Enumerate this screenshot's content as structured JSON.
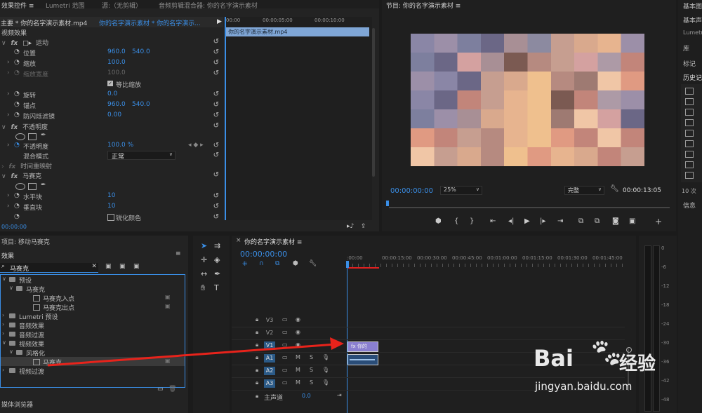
{
  "effect_controls": {
    "tabs": [
      "效果控件 ≡",
      "Lumetri 范围",
      "源:（无剪辑）",
      "音频剪辑混合器: 你的名字演示素材"
    ],
    "source_main": "主要 * 你的名字演示素材.mp4",
    "source_seq": "你的名字演示素材 * 你的名字演示...",
    "section_video": "视频效果",
    "motion": "运动",
    "position": "位置",
    "pos_x": "960.0",
    "pos_y": "540.0",
    "scale": "缩放",
    "scale_v": "100.0",
    "scale_w": "缩放宽度",
    "scale_w_v": "100.0",
    "uniform": "等比缩放",
    "rotation": "旋转",
    "rotation_v": "0.0",
    "anchor": "锚点",
    "anchor_x": "960.0",
    "anchor_y": "540.0",
    "flicker": "防闪烁滤镜",
    "flicker_v": "0.00",
    "opacity_group": "不透明度",
    "opacity": "不透明度",
    "opacity_v": "100.0 %",
    "blend": "混合模式",
    "blend_v": "正常",
    "timeremap": "时间重映射",
    "mosaic": "马赛克",
    "hblocks": "水平块",
    "hblocks_v": "10",
    "vblocks": "垂直块",
    "vblocks_v": "10",
    "sharpen": "锐化颜色",
    "timecode": "00:00:00",
    "mini_ruler": [
      "00:00",
      "00:00:05:00",
      "00:00:10:00"
    ],
    "clip": "你的名字演示素材.mp4"
  },
  "program": {
    "title": "节目: 你的名字演示素材 ≡",
    "timecode": "00:00:00:00",
    "zoom": "25%",
    "quality": "完整",
    "duration": "00:00:13:05"
  },
  "right_panel": {
    "items": [
      "基本图",
      "基本声",
      "Lumetri",
      "库",
      "标记",
      "历史记"
    ],
    "history_count": "10 次",
    "info": "信息"
  },
  "effects_panel": {
    "tabs": [
      "项目: 移动马赛克",
      "效果"
    ],
    "search": "马赛克",
    "tree": [
      {
        "label": "预设",
        "level": 0,
        "type": "folder"
      },
      {
        "label": "马赛克",
        "level": 1,
        "type": "folder"
      },
      {
        "label": "马赛克入点",
        "level": 2,
        "type": "fx"
      },
      {
        "label": "马赛克出点",
        "level": 2,
        "type": "fx"
      },
      {
        "label": "Lumetri 预设",
        "level": 0,
        "type": "folder"
      },
      {
        "label": "音频效果",
        "level": 0,
        "type": "folder"
      },
      {
        "label": "音频过渡",
        "level": 0,
        "type": "folder"
      },
      {
        "label": "视频效果",
        "level": 0,
        "type": "folder"
      },
      {
        "label": "风格化",
        "level": 1,
        "type": "folder"
      },
      {
        "label": "马赛克",
        "level": 2,
        "type": "fx"
      },
      {
        "label": "视频过渡",
        "level": 0,
        "type": "folder"
      }
    ],
    "bottom": "媒体浏览器"
  },
  "timeline": {
    "title": "你的名字演示素材 ≡",
    "timecode": "00:00:00:00",
    "ruler": [
      ":00:00",
      "00:00:15:00",
      "00:00:30:00",
      "00:00:45:00",
      "00:01:00:00",
      "00:01:15:00",
      "00:01:30:00",
      "00:01:45:00"
    ],
    "tracks": [
      "V3",
      "V2",
      "V1",
      "A1",
      "A2",
      "A3"
    ],
    "master": "主声道",
    "master_v": "0.0",
    "clip_label": "fx 你的",
    "meter": [
      "0",
      "-6",
      "-12",
      "-18",
      "-24",
      "-30",
      "-36",
      "-42",
      "-48"
    ]
  },
  "watermark": {
    "brand": "Bai",
    "brand2": "经验",
    "url": "jingyan.baidu.com"
  },
  "colors": {
    "accent": "#3a8ee6",
    "arrow": "#e8231b",
    "clip_video": "#8a7fd0"
  }
}
